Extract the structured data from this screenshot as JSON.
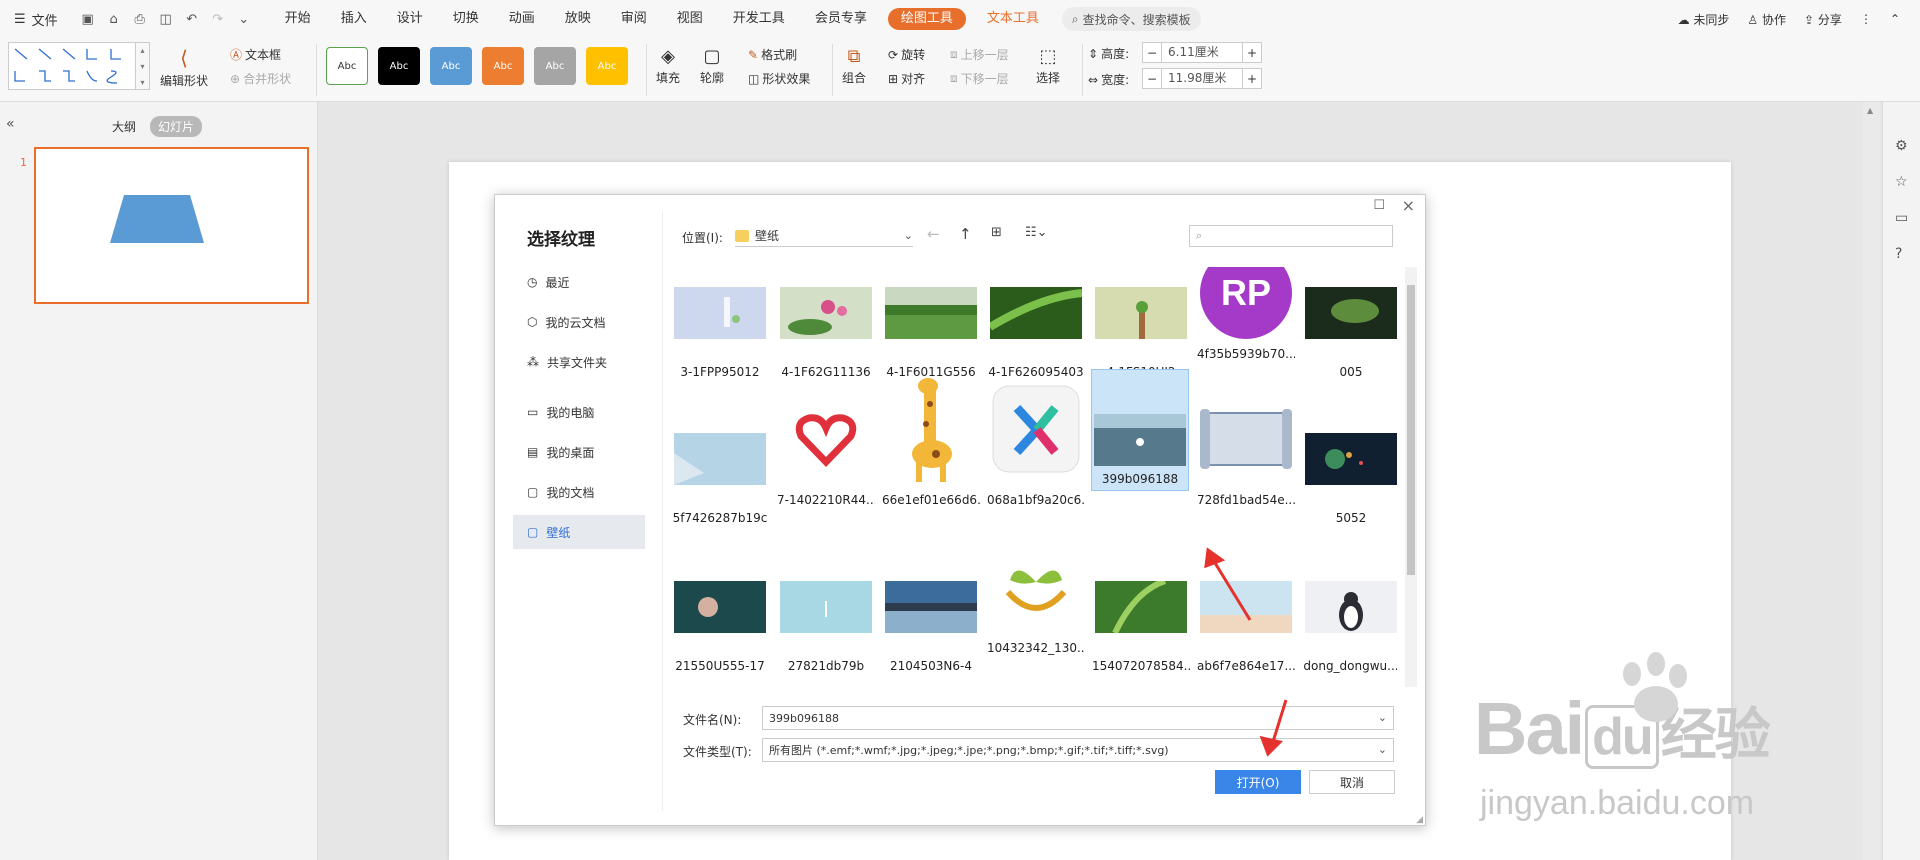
{
  "menubar": {
    "file_label": "文件",
    "tabs": [
      "开始",
      "插入",
      "设计",
      "切换",
      "动画",
      "放映",
      "审阅",
      "视图",
      "开发工具",
      "会员专享"
    ],
    "highlight_tab": "绘图工具",
    "text_tab": "文本工具",
    "search_placeholder": "查找命令、搜索模板",
    "right": {
      "sync": "未同步",
      "collab": "协作",
      "share": "分享"
    }
  },
  "ribbon": {
    "edit_shape": "编辑形状",
    "textbox": "文本框",
    "merge_shape": "合并形状",
    "style_text": "Abc",
    "style_colors": [
      "#ffffff",
      "#000000",
      "#5b9bd5",
      "#ed7d31",
      "#a5a5a5",
      "#ffc000"
    ],
    "fill": "填充",
    "outline": "轮廓",
    "format_brush": "格式刷",
    "shape_effect": "形状效果",
    "group": "组合",
    "rotate": "旋转",
    "align": "对齐",
    "bring_forward": "上移一层",
    "send_backward": "下移一层",
    "select": "选择",
    "height_label": "高度:",
    "height_value": "6.11厘米",
    "width_label": "宽度:",
    "width_value": "11.98厘米"
  },
  "left_panel": {
    "tab_outline": "大纲",
    "tab_slides": "幻灯片",
    "slide_number": "1"
  },
  "dialog": {
    "title": "选择纹理",
    "location_label": "位置(I):",
    "location_value": "壁纸",
    "nav": [
      {
        "label": "最近",
        "icon": "clock-icon"
      },
      {
        "label": "我的云文档",
        "icon": "cloud-doc-icon"
      },
      {
        "label": "共享文件夹",
        "icon": "share-folder-icon"
      },
      {
        "label": "我的电脑",
        "icon": "computer-icon"
      },
      {
        "label": "我的桌面",
        "icon": "desktop-icon"
      },
      {
        "label": "我的文档",
        "icon": "documents-icon"
      },
      {
        "label": "壁纸",
        "icon": "wallpaper-icon"
      }
    ],
    "files": [
      [
        "3-1FPP95012",
        "4-1F62G11136",
        "4-1F6011G556",
        "4-1F626095403",
        "4-1FS10UJ2",
        "4f35b5939b70...",
        "005"
      ],
      [
        "5f7426287b19c",
        "7-1402210R44...",
        "66e1ef01e66d6...",
        "068a1bf9a20c6...",
        "399b096188",
        "728fd1bad54e...",
        "5052"
      ],
      [
        "21550U555-17",
        "27821db79b",
        "2104503N6-4",
        "10432342_130...",
        "154072078584...",
        "ab6f7e864e17...",
        "dong_dongwu..."
      ]
    ],
    "selected_file": "399b096188",
    "filename_label": "文件名(N):",
    "filename_value": "399b096188",
    "filetype_label": "文件类型(T):",
    "filetype_value": "所有图片 (*.emf;*.wmf;*.jpg;*.jpeg;*.jpe;*.png;*.bmp;*.gif;*.tif;*.tiff;*.svg)",
    "open_button": "打开(O)",
    "cancel_button": "取消",
    "rp_logo": "RP"
  },
  "watermark": {
    "brand": "Bai",
    "brand2": "du",
    "cn": "经验",
    "url": "jingyan.baidu.com"
  }
}
